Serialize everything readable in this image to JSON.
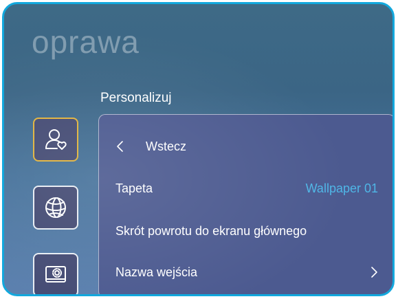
{
  "background_title": "oprawa",
  "section": {
    "heading": "Personalizuj"
  },
  "sidebar": {
    "items": [
      {
        "icon": "user-heart-icon",
        "selected": true
      },
      {
        "icon": "globe-icon",
        "selected": false
      },
      {
        "icon": "monitor-settings-icon",
        "selected": false
      }
    ]
  },
  "panel": {
    "back_label": "Wstecz",
    "items": [
      {
        "label": "Tapeta",
        "value": "Wallpaper 01"
      },
      {
        "label": "Skrót powrotu do ekranu głównego"
      },
      {
        "label": "Nazwa wejścia"
      }
    ]
  },
  "colors": {
    "accent_value": "#4fb6e6",
    "selected_border": "#e2b33a",
    "frame_border": "#12a8dd"
  }
}
